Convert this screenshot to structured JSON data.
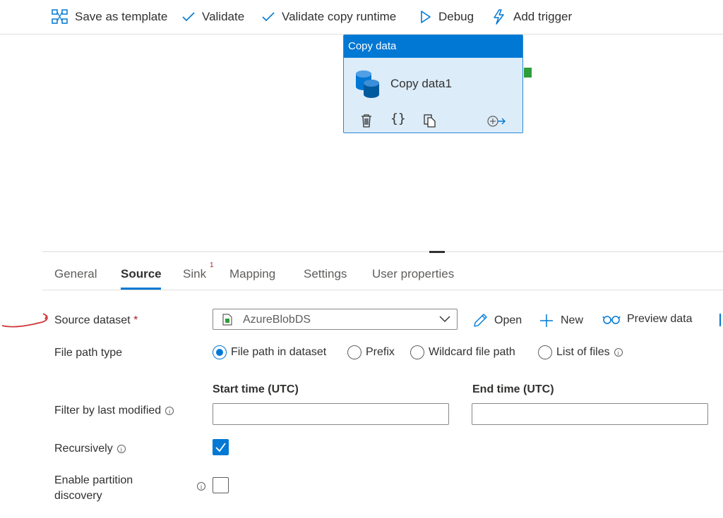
{
  "toolbar": {
    "save_template": "Save as template",
    "validate": "Validate",
    "validate_copy_runtime": "Validate copy runtime",
    "debug": "Debug",
    "add_trigger": "Add trigger"
  },
  "activity": {
    "type_label": "Copy data",
    "name": "Copy data1",
    "icons": [
      "delete-icon",
      "code-icon",
      "copy-icon",
      "add-output-icon"
    ]
  },
  "tabs": [
    {
      "label": "General"
    },
    {
      "label": "Source",
      "active": true
    },
    {
      "label": "Sink",
      "badge": "1"
    },
    {
      "label": "Mapping"
    },
    {
      "label": "Settings"
    },
    {
      "label": "User properties"
    }
  ],
  "form": {
    "source_dataset": {
      "label": "Source dataset",
      "required_mark": "*",
      "value": "AzureBlobDS",
      "actions": {
        "open": "Open",
        "new": "New",
        "preview": "Preview data"
      }
    },
    "file_path_type": {
      "label": "File path type",
      "options": [
        "File path in dataset",
        "Prefix",
        "Wildcard file path",
        "List of files"
      ],
      "selected": "File path in dataset"
    },
    "filter": {
      "label": "Filter by last modified",
      "start_label": "Start time (UTC)",
      "end_label": "End time (UTC)",
      "start_value": "",
      "end_value": ""
    },
    "recursively": {
      "label": "Recursively",
      "checked": true
    },
    "partition_discovery": {
      "label_line1": "Enable partition",
      "label_line2": "discovery",
      "checked": false
    }
  },
  "colors": {
    "accent": "#0078d4",
    "annotation": "#d13438",
    "port": "#2e9d3a"
  }
}
